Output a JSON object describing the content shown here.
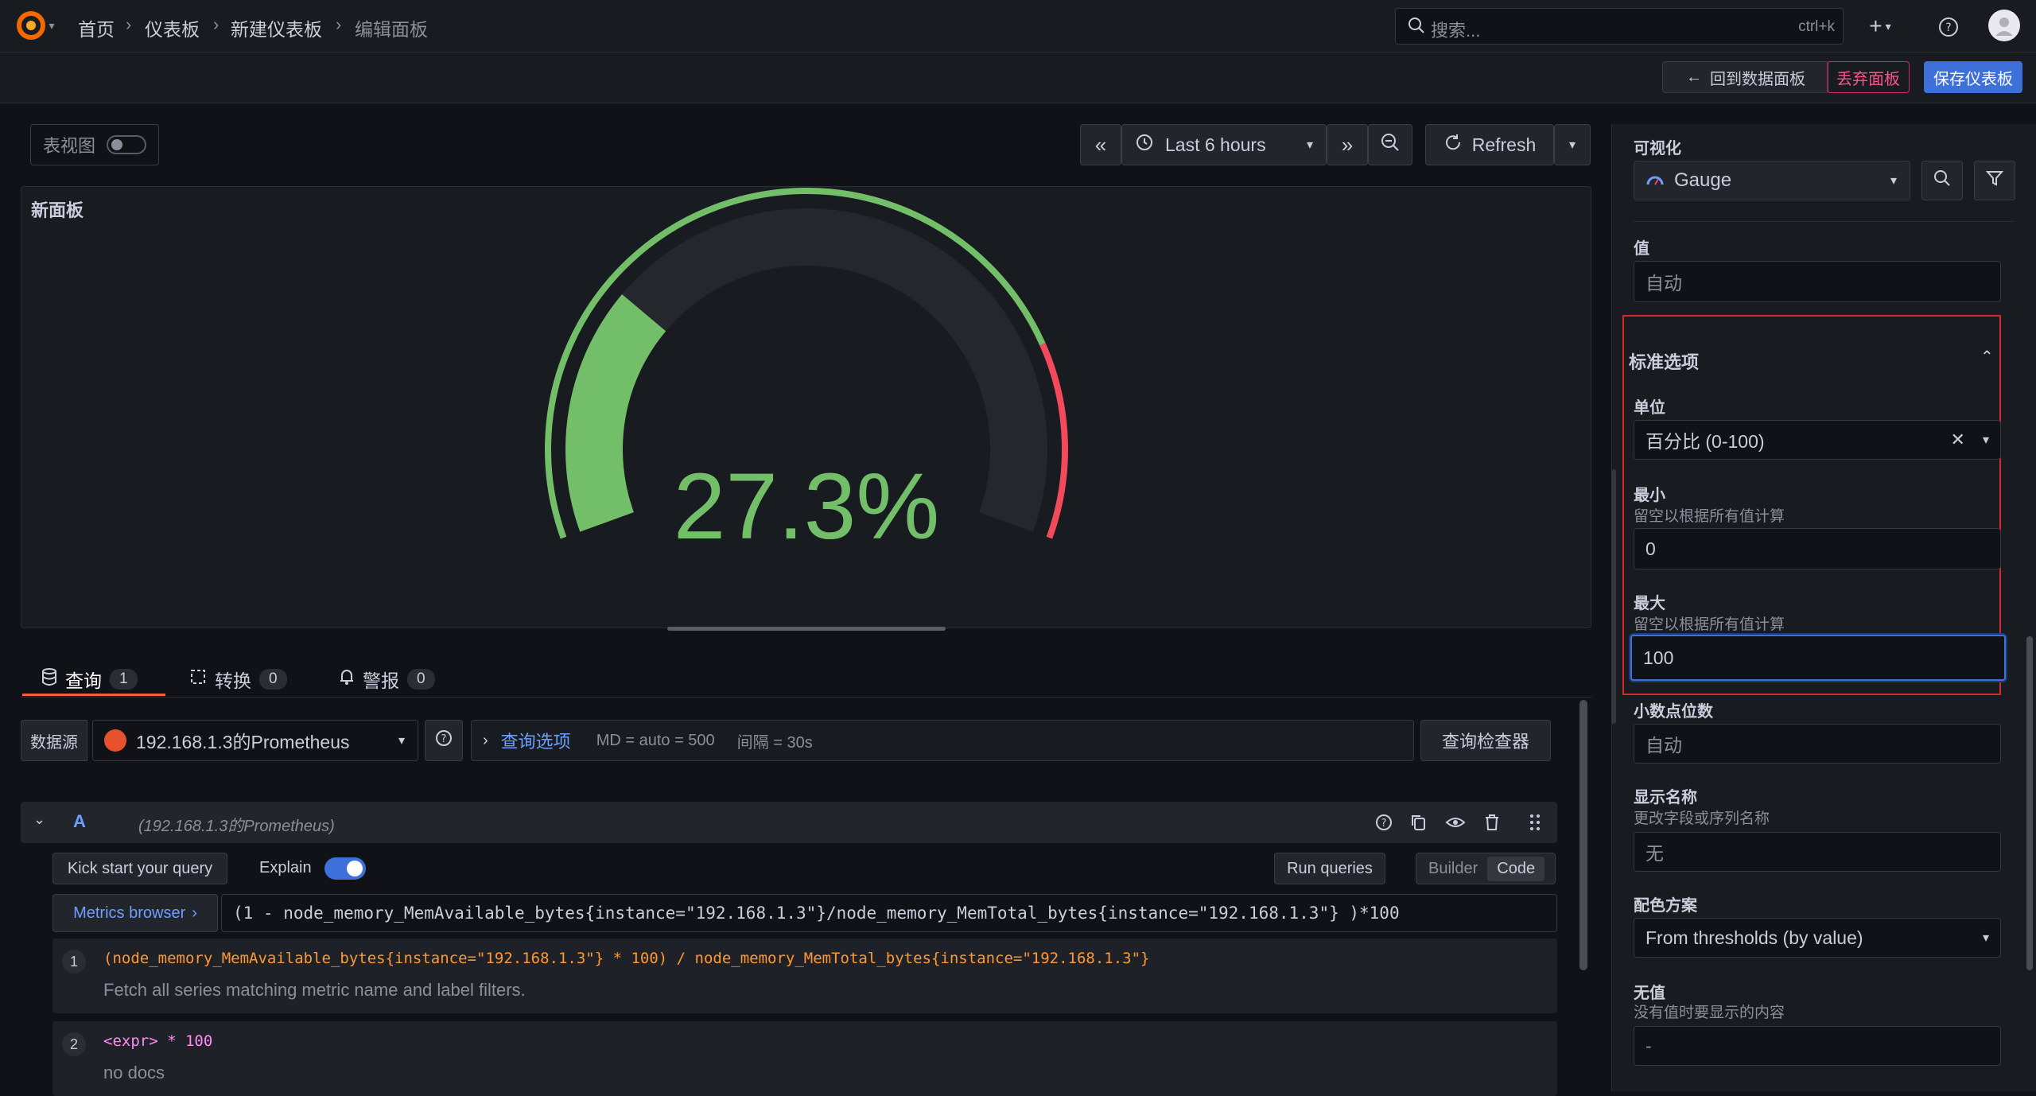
{
  "breadcrumb": {
    "home": "首页",
    "dashboards": "仪表板",
    "new_dashboard": "新建仪表板",
    "edit_panel": "编辑面板"
  },
  "search": {
    "placeholder": "搜索...",
    "shortcut": "ctrl+k"
  },
  "subbar": {
    "back_label": "回到数据面板",
    "discard_label": "丢弃面板",
    "save_label": "保存仪表板"
  },
  "toolbar": {
    "table_view_label": "表视图",
    "time_range": "Last 6 hours",
    "refresh_label": "Refresh"
  },
  "panel": {
    "title": "新面板",
    "gauge_value": 27.3,
    "gauge_text": "27.3",
    "gauge_unit": "%",
    "min": 0,
    "max": 100,
    "threshold": 80,
    "colors": {
      "ok": "#73bf69",
      "alert": "#f2495c"
    }
  },
  "tabs": [
    {
      "label": "查询",
      "count": "1"
    },
    {
      "label": "转换",
      "count": "0"
    },
    {
      "label": "警报",
      "count": "0"
    }
  ],
  "query_bar": {
    "datasource_label": "数据源",
    "datasource_name": "192.168.1.3的Prometheus",
    "options_label": "查询选项",
    "md_info": "MD = auto = 500",
    "interval_info": "间隔 = 30s",
    "inspector_label": "查询检查器"
  },
  "query_a": {
    "ref": "A",
    "datasource": "(192.168.1.3的Prometheus)",
    "kick_start_label": "Kick start your query",
    "explain_label": "Explain",
    "run_label": "Run queries",
    "builder_label": "Builder",
    "code_label": "Code",
    "metrics_browser_label": "Metrics browser",
    "expression": "(1 - node_memory_MemAvailable_bytes{instance=\"192.168.1.3\"}/node_memory_MemTotal_bytes{instance=\"192.168.1.3\"} )*100",
    "explain_steps": [
      {
        "num": "1",
        "code": "(node_memory_MemAvailable_bytes{instance=\"192.168.1.3\"} * 100) / node_memory_MemTotal_bytes{instance=\"192.168.1.3\"}",
        "doc": "Fetch all series matching metric name and label filters."
      },
      {
        "num": "2",
        "code": "<expr> * 100",
        "doc": "no docs"
      }
    ]
  },
  "options": {
    "visualization_label": "可视化",
    "visualization_value": "Gauge",
    "value_label": "值",
    "value_placeholder": "自动",
    "standard_options_label": "标准选项",
    "unit_label": "单位",
    "unit_value": "百分比 (0-100)",
    "min_label": "最小",
    "min_desc": "留空以根据所有值计算",
    "min_value": "0",
    "max_label": "最大",
    "max_desc": "留空以根据所有值计算",
    "max_value": "100",
    "decimals_label": "小数点位数",
    "decimals_placeholder": "自动",
    "display_name_label": "显示名称",
    "display_name_desc": "更改字段或序列名称",
    "display_name_placeholder": "无",
    "color_scheme_label": "配色方案",
    "color_scheme_value": "From thresholds (by value)",
    "no_value_label": "无值",
    "no_value_desc": "没有值时要显示的内容",
    "no_value_placeholder": "-"
  }
}
